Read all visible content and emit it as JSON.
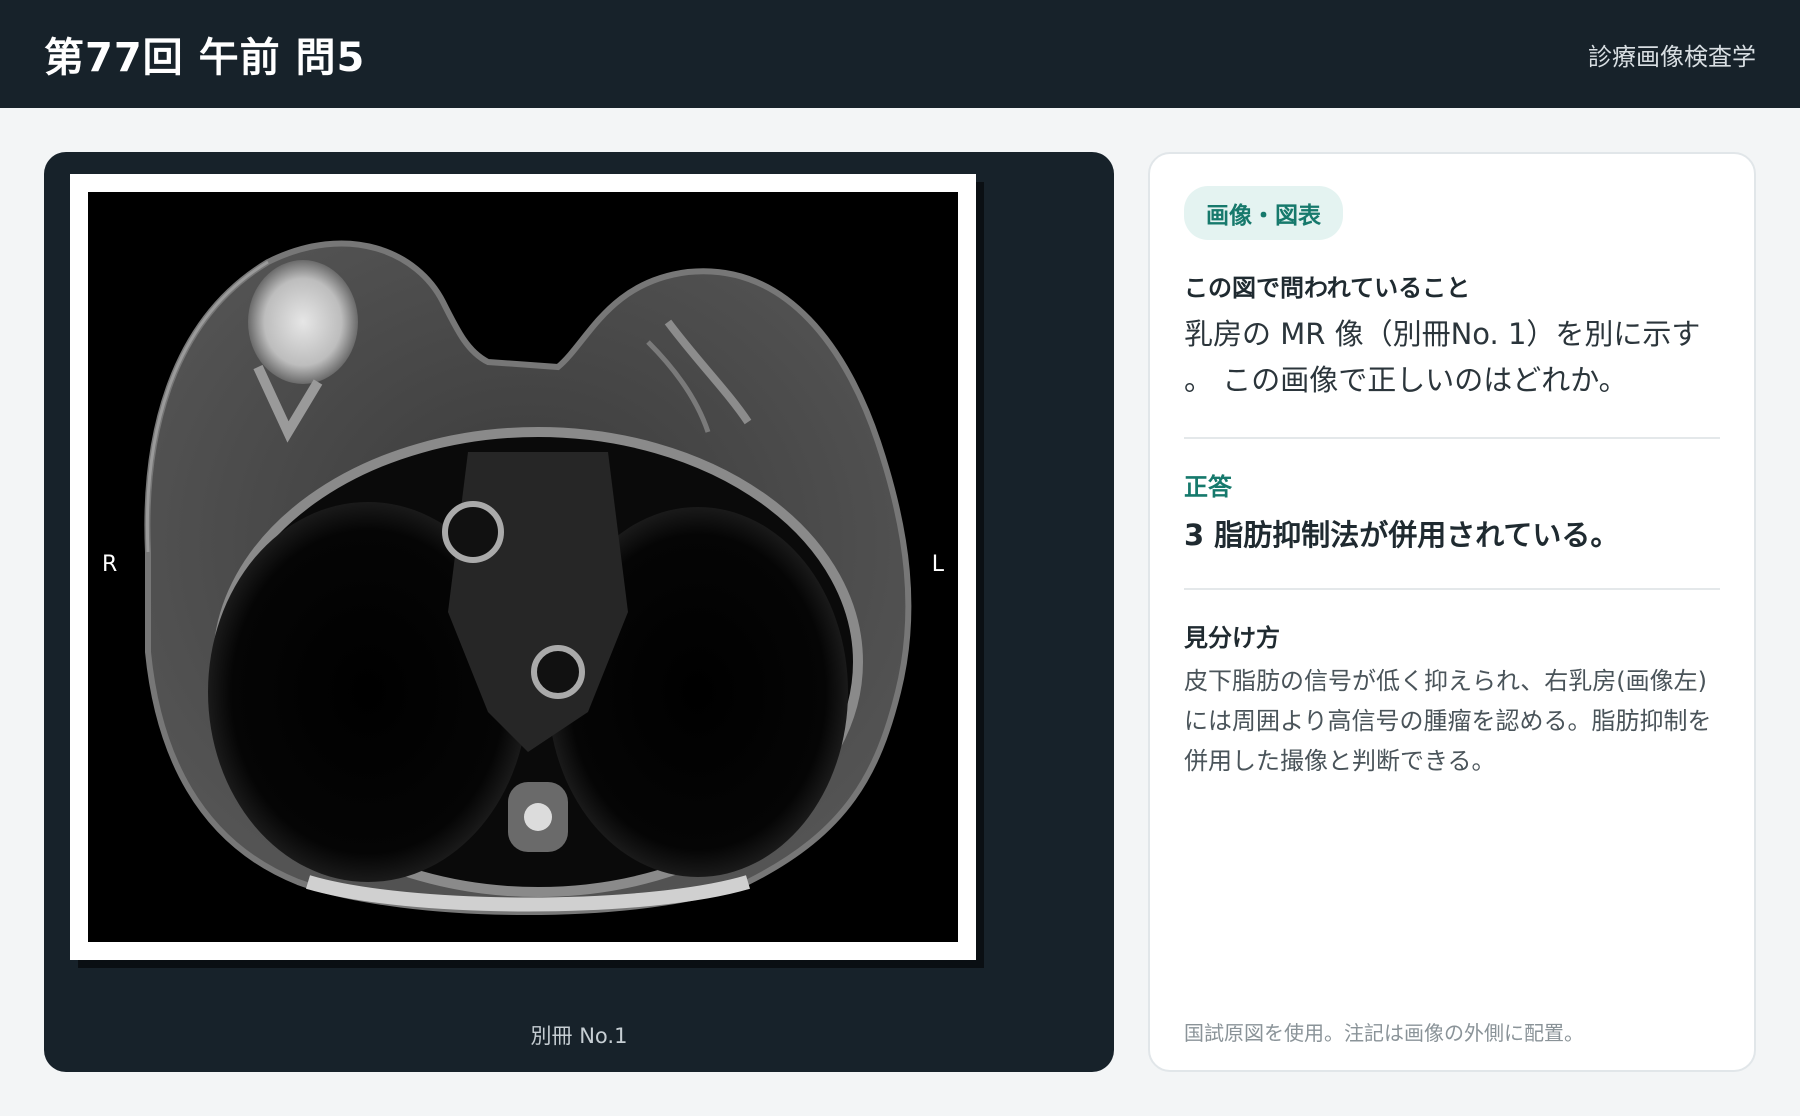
{
  "header": {
    "title": "第77回 午前 問5",
    "subject": "診療画像検査学"
  },
  "viewer": {
    "orientation_right": "R",
    "orientation_left": "L",
    "caption": "別冊 No.1"
  },
  "panel": {
    "badge": "画像・図表",
    "question_heading": "この図で問われていること",
    "question_text": "乳房の MR 像（別冊No. 1）を別に示す 。 この画像で正しいのはどれか。",
    "answer_heading": "正答",
    "answer_text": "3 脂肪抑制法が併用されている。",
    "tip_heading": "見分け方",
    "tip_text": "皮下脂肪の信号が低く抑えられ、右乳房(画像左)には周囲より高信号の腫瘤を認める。脂肪抑制を併用した撮像と判断できる。",
    "note": "国試原図を使用。注記は画像の外側に配置。"
  },
  "colors": {
    "header_bg": "#17222a",
    "accent": "#16796c",
    "page_bg": "#f3f5f6"
  }
}
